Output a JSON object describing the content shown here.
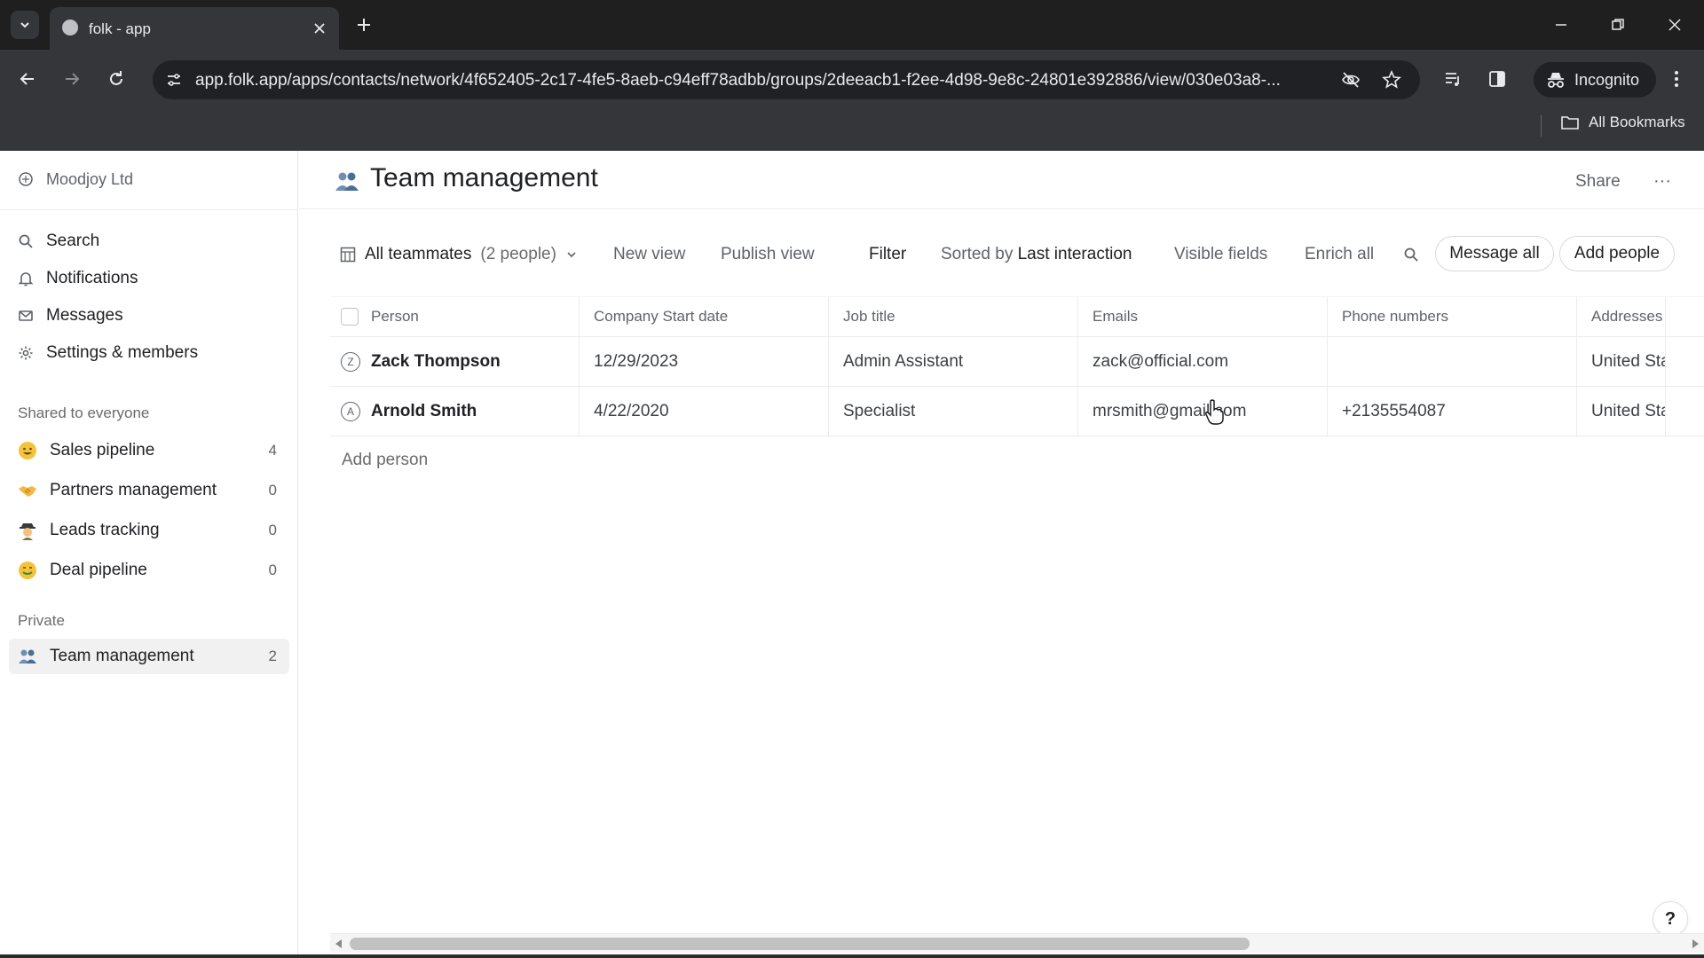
{
  "browser": {
    "tab_title": "folk - app",
    "url": "app.folk.app/apps/contacts/network/4f652405-2c17-4fe5-8aeb-c94eff78adbb/groups/2deeacb1-f2ee-4d98-9e8c-24801e392886/view/030e03a8-...",
    "incognito_label": "Incognito",
    "bookmarks_label": "All Bookmarks"
  },
  "sidebar": {
    "workspace": "Moodjoy Ltd",
    "nav": [
      {
        "label": "Search",
        "icon": "search-icon"
      },
      {
        "label": "Notifications",
        "icon": "bell-icon"
      },
      {
        "label": "Messages",
        "icon": "mail-icon"
      },
      {
        "label": "Settings & members",
        "icon": "gear-icon"
      }
    ],
    "shared_heading": "Shared to everyone",
    "shared_groups": [
      {
        "label": "Sales pipeline",
        "count": "4",
        "icon": "grinning-face-emoji"
      },
      {
        "label": "Partners management",
        "count": "0",
        "icon": "handshake-emoji"
      },
      {
        "label": "Leads tracking",
        "count": "0",
        "icon": "detective-emoji"
      },
      {
        "label": "Deal pipeline",
        "count": "0",
        "icon": "money-mouth-emoji"
      }
    ],
    "private_heading": "Private",
    "private_groups": [
      {
        "label": "Team management",
        "count": "2",
        "icon": "people-icon",
        "active": true
      }
    ]
  },
  "header": {
    "title": "Team management",
    "share_label": "Share",
    "more_label": "···"
  },
  "viewbar": {
    "view_name": "All teammates",
    "view_count": "(2 people)",
    "new_view": "New view",
    "publish_view": "Publish view",
    "filter": "Filter",
    "sorted_prefix": "Sorted by",
    "sorted_field": "Last interaction",
    "visible_fields": "Visible fields",
    "enrich_all": "Enrich all",
    "message_all": "Message all",
    "add_people": "Add people"
  },
  "table": {
    "columns": [
      "Person",
      "Company Start date",
      "Job title",
      "Emails",
      "Phone numbers",
      "Addresses"
    ],
    "rows": [
      {
        "initial": "Z",
        "person": "Zack Thompson",
        "start_date": "12/29/2023",
        "job_title": "Admin Assistant",
        "email": "zack@official.com",
        "phone": "",
        "address": "United States"
      },
      {
        "initial": "A",
        "person": "Arnold Smith",
        "start_date": "4/22/2020",
        "job_title": "Specialist",
        "email": "mrsmith@gmail.com",
        "phone": "+2135554087",
        "address": "United States"
      }
    ],
    "add_person_label": "Add person"
  },
  "help_label": "?"
}
